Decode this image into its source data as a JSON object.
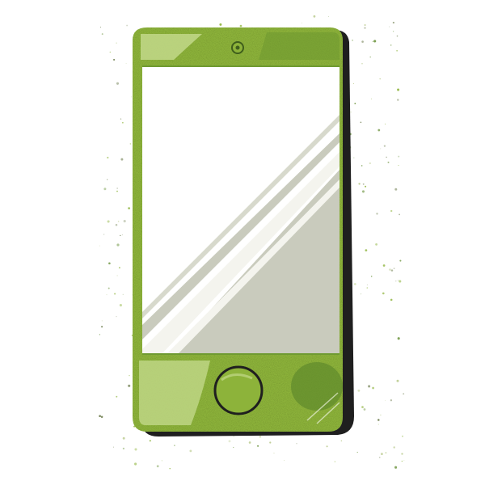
{
  "illustration": {
    "subject": "smartphone-illustration",
    "colors": {
      "body_green": "#8db33a",
      "body_light": "#c2d889",
      "body_dark": "#5f8a2c",
      "outline": "#1f1f1f",
      "screen": "#ffffff",
      "screen_shadow": "#c9cbbd",
      "glare": "#f4f4ee"
    },
    "elements": [
      "front-camera-icon",
      "screen",
      "home-button-icon"
    ]
  }
}
